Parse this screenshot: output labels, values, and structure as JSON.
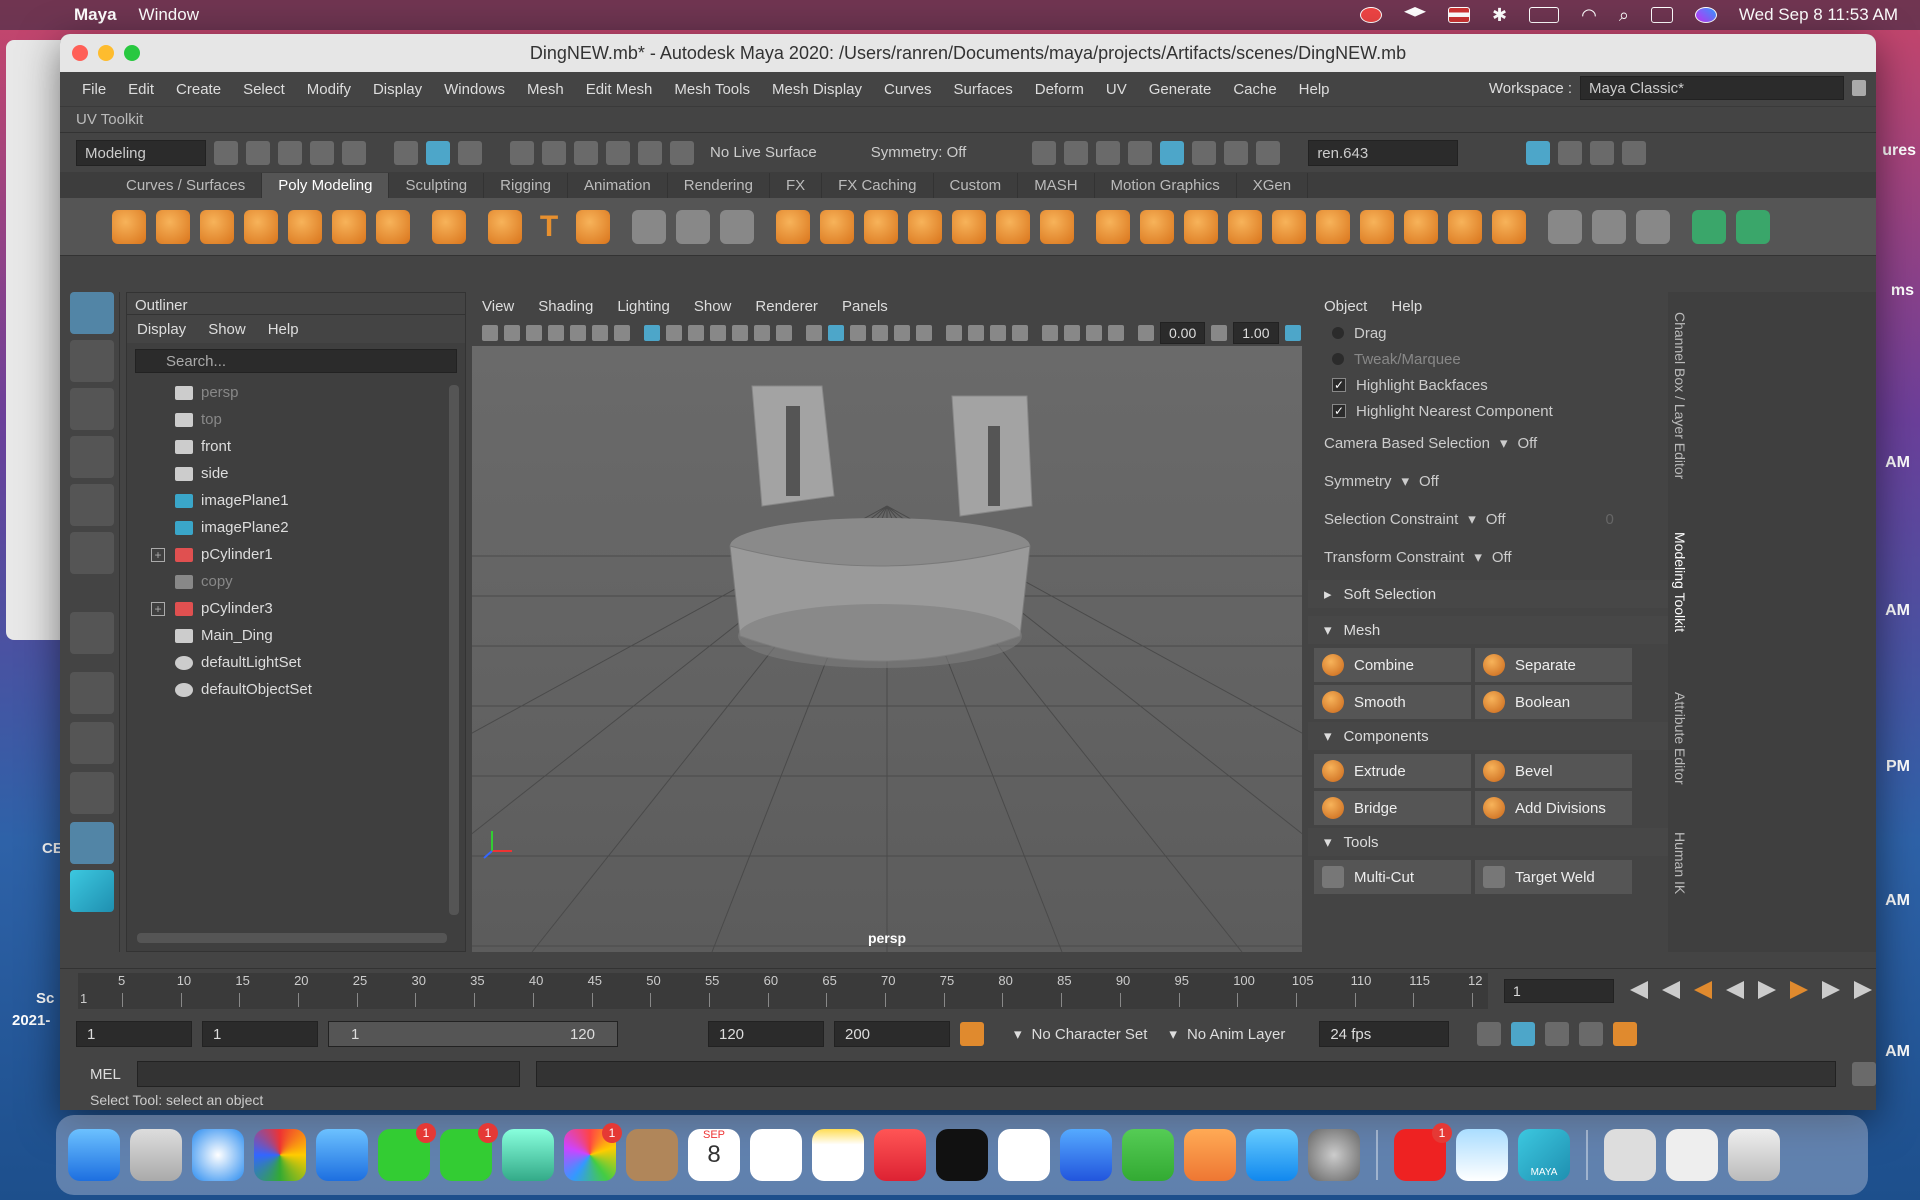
{
  "menubar": {
    "app_name": "Maya",
    "items": [
      "Window"
    ],
    "datetime": "Wed Sep 8  11:53 AM"
  },
  "desktop": {
    "labels": [
      "CE",
      "Sc",
      "2021-"
    ],
    "right_labels": [
      "ures",
      "ms",
      "AM",
      "AM",
      "PM",
      "AM",
      "AM"
    ]
  },
  "window": {
    "title": "DingNEW.mb* - Autodesk Maya 2020: /Users/ranren/Documents/maya/projects/Artifacts/scenes/DingNEW.mb",
    "menus": [
      "File",
      "Edit",
      "Create",
      "Select",
      "Modify",
      "Display",
      "Windows",
      "Mesh",
      "Edit Mesh",
      "Mesh Tools",
      "Mesh Display",
      "Curves",
      "Surfaces",
      "Deform",
      "UV",
      "Generate",
      "Cache",
      "Help"
    ],
    "workspace_label": "Workspace :",
    "workspace_value": "Maya Classic*",
    "uv_toolkit": "UV Toolkit"
  },
  "statusline": {
    "mode": "Modeling",
    "live_surface": "No Live Surface",
    "symmetry": "Symmetry: Off",
    "user": "ren.643"
  },
  "shelf_tabs": [
    "Curves / Surfaces",
    "Poly Modeling",
    "Sculpting",
    "Rigging",
    "Animation",
    "Rendering",
    "FX",
    "FX Caching",
    "Custom",
    "MASH",
    "Motion Graphics",
    "XGen"
  ],
  "active_shelf_tab": "Poly Modeling",
  "outliner": {
    "title": "Outliner",
    "menu": [
      "Display",
      "Show",
      "Help"
    ],
    "search_placeholder": "Search...",
    "items": [
      {
        "label": "persp",
        "dim": true
      },
      {
        "label": "top",
        "dim": true
      },
      {
        "label": "front",
        "dim": false
      },
      {
        "label": "side",
        "dim": false
      },
      {
        "label": "imagePlane1",
        "dim": false
      },
      {
        "label": "imagePlane2",
        "dim": false
      },
      {
        "label": "pCylinder1",
        "dim": false,
        "expand": true
      },
      {
        "label": "copy",
        "dim": true
      },
      {
        "label": "pCylinder3",
        "dim": false,
        "expand": true
      },
      {
        "label": "Main_Ding",
        "dim": false
      },
      {
        "label": "defaultLightSet",
        "dim": false
      },
      {
        "label": "defaultObjectSet",
        "dim": false
      }
    ]
  },
  "viewport": {
    "menu": [
      "View",
      "Shading",
      "Lighting",
      "Show",
      "Renderer",
      "Panels"
    ],
    "field_a": "0.00",
    "field_b": "1.00",
    "camera_label": "persp"
  },
  "toolkit": {
    "menu": [
      "Object",
      "Help"
    ],
    "drag": "Drag",
    "tweak": "Tweak/Marquee",
    "highlight_backfaces": "Highlight Backfaces",
    "highlight_nearest": "Highlight Nearest Component",
    "camera_based": "Camera Based Selection",
    "camera_based_val": "Off",
    "symmetry": "Symmetry",
    "symmetry_val": "Off",
    "sel_constraint": "Selection Constraint",
    "sel_constraint_val": "Off",
    "sel_constraint_num": "0",
    "xform_constraint": "Transform Constraint",
    "xform_constraint_val": "Off",
    "soft_selection": "Soft Selection",
    "mesh": "Mesh",
    "components": "Components",
    "tools": "Tools",
    "mesh_buttons": [
      "Combine",
      "Separate",
      "Smooth",
      "Boolean"
    ],
    "component_buttons": [
      "Extrude",
      "Bevel",
      "Bridge",
      "Add Divisions"
    ],
    "tool_buttons": [
      "Multi-Cut",
      "Target Weld"
    ]
  },
  "side_tabs": [
    "Channel Box / Layer Editor",
    "Modeling Toolkit",
    "Attribute Editor",
    "Human IK"
  ],
  "timeline": {
    "ticks": [
      "5",
      "10",
      "15",
      "20",
      "25",
      "30",
      "35",
      "40",
      "45",
      "50",
      "55",
      "60",
      "65",
      "70",
      "75",
      "80",
      "85",
      "90",
      "95",
      "100",
      "105",
      "110",
      "115",
      "12"
    ],
    "start_marker": "1",
    "current_frame": "1"
  },
  "range": {
    "start": "1",
    "start2": "1",
    "slider_start": "1",
    "slider_end": "120",
    "end": "120",
    "end2": "200",
    "char_set": "No Character Set",
    "anim_layer": "No Anim Layer",
    "fps": "24 fps"
  },
  "mel": {
    "label": "MEL",
    "help": "Select Tool: select an object"
  },
  "dock": {
    "badges": [
      "1",
      "1",
      "1",
      "1"
    ],
    "calendar_month": "SEP",
    "calendar_day": "8",
    "maya_label": "MAYA"
  },
  "colors": {
    "accent_orange": "#e08a2e",
    "accent_blue": "#4da6c9",
    "maya_bg": "#444444"
  }
}
